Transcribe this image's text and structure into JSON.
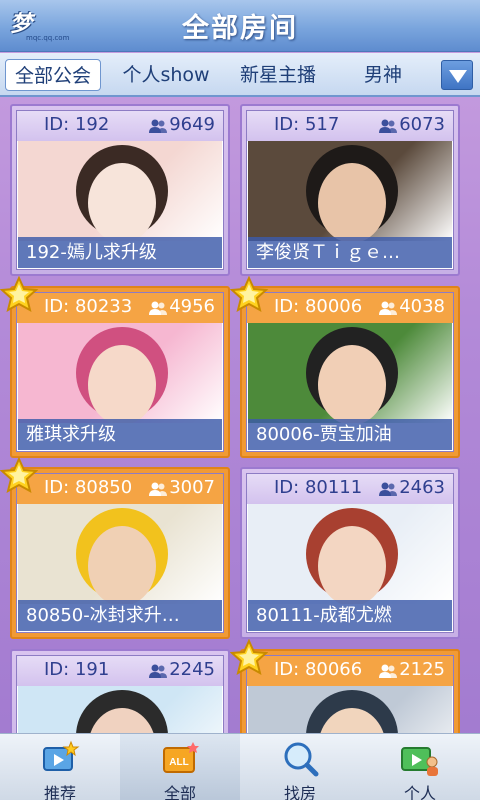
{
  "header": {
    "title": "全部房间",
    "logo_text": "梦",
    "logo_sub": "mqc.qq.com"
  },
  "tabs": [
    {
      "label": "全部公会",
      "active": true
    },
    {
      "label": "个人show",
      "active": false
    },
    {
      "label": "新星主播",
      "active": false
    },
    {
      "label": "男神",
      "active": false
    }
  ],
  "rooms": [
    {
      "id": "ID: 192",
      "viewers": "9649",
      "caption": "192-嫣儿求升级",
      "style": "blue",
      "star": false
    },
    {
      "id": "ID: 517",
      "viewers": "6073",
      "caption": "李俊贤Ｔｉｇｅ…",
      "style": "blue",
      "star": false
    },
    {
      "id": "ID: 80233",
      "viewers": "4956",
      "caption": "雅琪求升级",
      "style": "orange",
      "star": true
    },
    {
      "id": "ID: 80006",
      "viewers": "4038",
      "caption": "80006-贾宝加油",
      "style": "orange",
      "star": true
    },
    {
      "id": "ID: 80850",
      "viewers": "3007",
      "caption": "80850-冰封求升…",
      "style": "orange",
      "star": true
    },
    {
      "id": "ID: 80111",
      "viewers": "2463",
      "caption": "80111-成都尤燃",
      "style": "blue",
      "star": false
    },
    {
      "id": "ID: 191",
      "viewers": "2245",
      "caption": "",
      "style": "blue",
      "star": false
    },
    {
      "id": "ID: 80066",
      "viewers": "2125",
      "caption": "",
      "style": "orange",
      "star": true
    }
  ],
  "bottom_nav": [
    {
      "label": "推荐",
      "icon": "recommend-tv-icon",
      "active": false
    },
    {
      "label": "全部",
      "icon": "all-tv-icon",
      "active": true,
      "badge": "ALL"
    },
    {
      "label": "找房",
      "icon": "search-icon",
      "active": false
    },
    {
      "label": "个人",
      "icon": "person-tv-icon",
      "active": false
    }
  ],
  "colors": {
    "header_blue": "#7aa5dd",
    "tab_text": "#1f3f78",
    "orange_card": "#f19a35",
    "purple_card": "#c7b0e6",
    "caption_bg": "#3c5aaa"
  }
}
